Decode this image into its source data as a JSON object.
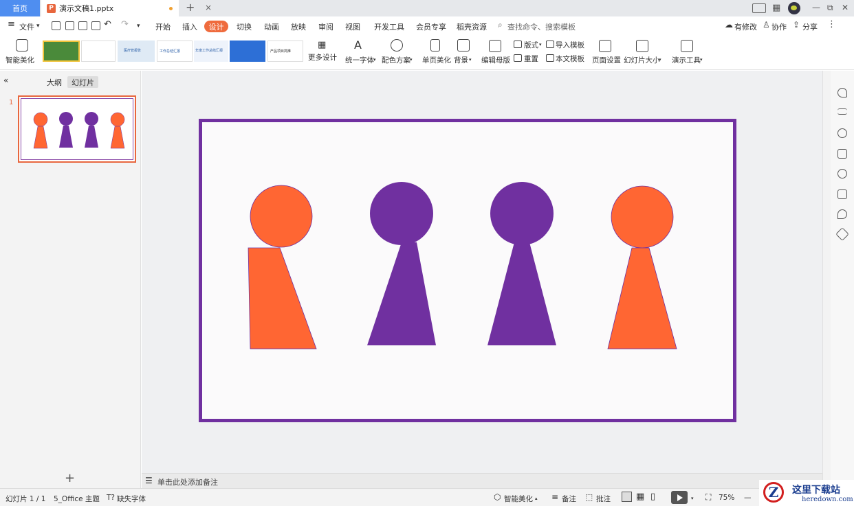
{
  "tabs": {
    "home": "首页",
    "doc_title": "演示文稿1.pptx",
    "close": "×",
    "add": "+"
  },
  "window": {
    "minimize": "—",
    "restore": "⧉",
    "close": "✕"
  },
  "menu": {
    "file": "文件",
    "items": [
      "开始",
      "插入",
      "设计",
      "切换",
      "动画",
      "放映",
      "审阅",
      "视图",
      "开发工具",
      "会员专享",
      "稻壳资源"
    ],
    "active": "设计",
    "search_placeholder": "查找命令、搜索模板",
    "right": [
      "有修改",
      "协作",
      "分享"
    ]
  },
  "ribbon": {
    "smart_beautify": "智能美化",
    "more_design": "更多设计",
    "unify_font": "统一字体",
    "color_scheme": "配色方案",
    "page_beautify": "单页美化",
    "background": "背景",
    "edit_master": "编辑母版",
    "layout": "版式",
    "reset": "重置",
    "import_template": "导入模板",
    "doc_template": "本文模板",
    "page_setup": "页面设置",
    "slide_size": "幻灯片大小",
    "presentation_tools": "演示工具",
    "template_thumbs": [
      {
        "color": "#4a8a3a",
        "text": ""
      },
      {
        "color": "#ffffff",
        "text": ""
      },
      {
        "color": "#dfeaf5",
        "text": "医疗管报告"
      },
      {
        "color": "#ffffff",
        "text": "工作总结汇报"
      },
      {
        "color": "#2d6fd6",
        "text": "年度工作总结汇报"
      },
      {
        "color": "#ffffff",
        "text": "产品项目简推"
      }
    ]
  },
  "left_panel": {
    "outline": "大纲",
    "slides": "幻灯片",
    "slide_number": "1",
    "add": "+"
  },
  "slide": {
    "border_color": "#7030a0",
    "pieces": [
      {
        "color": "#ff6633"
      },
      {
        "color": "#7030a0"
      },
      {
        "color": "#7030a0"
      },
      {
        "color": "#ff6633"
      }
    ]
  },
  "notes": {
    "placeholder": "单击此处添加备注"
  },
  "status": {
    "slide_count": "幻灯片 1 / 1",
    "theme": "5_Office 主题",
    "missing_font": "缺失字体",
    "smart_beautify": "智能美化",
    "notes": "备注",
    "comments": "批注",
    "zoom": "75%"
  },
  "watermark": {
    "cn": "这里下载站",
    "en": "heredown.com",
    "logo": "Z"
  }
}
